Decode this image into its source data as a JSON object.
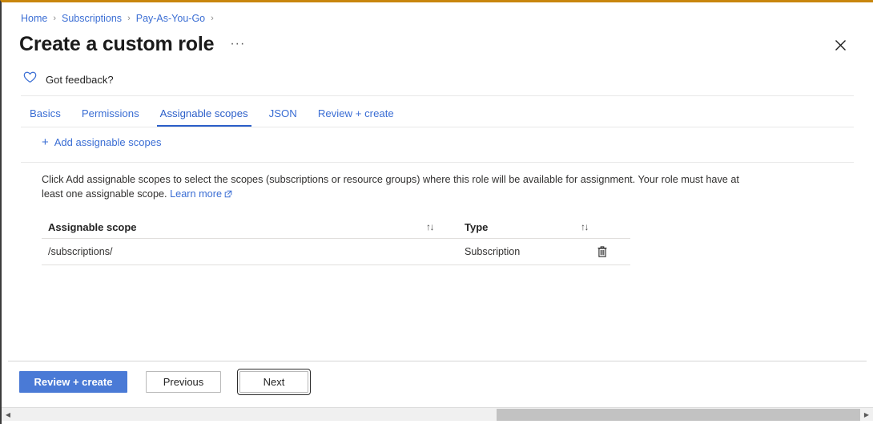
{
  "window": {
    "accent_top_border": "#c8860d",
    "close_icon": "close-icon"
  },
  "breadcrumb": {
    "items": [
      {
        "label": "Home"
      },
      {
        "label": "Subscriptions"
      },
      {
        "label": "Pay-As-You-Go"
      }
    ],
    "separator": "›"
  },
  "header": {
    "title": "Create a custom role",
    "ellipsis": "···"
  },
  "feedback": {
    "icon": "heart-icon",
    "label": "Got feedback?"
  },
  "tabs": [
    {
      "label": "Basics",
      "active": false
    },
    {
      "label": "Permissions",
      "active": false
    },
    {
      "label": "Assignable scopes",
      "active": true
    },
    {
      "label": "JSON",
      "active": false
    },
    {
      "label": "Review + create",
      "active": false
    }
  ],
  "command_bar": {
    "add_scope_plus": "+",
    "add_scope_label": "Add assignable scopes"
  },
  "description": {
    "text": "Click Add assignable scopes to select the scopes (subscriptions or resource groups) where this role will be available for assignment. Your role must have at least one assignable scope.",
    "link_label": "Learn more",
    "link_icon": "external-link-icon"
  },
  "table": {
    "columns": [
      {
        "key": "scope",
        "label": "Assignable scope",
        "sort_icon": "↑↓"
      },
      {
        "key": "type",
        "label": "Type",
        "sort_icon": "↑↓"
      }
    ],
    "rows": [
      {
        "scope": "/subscriptions/",
        "type": "Subscription",
        "delete_icon": "trash-icon"
      }
    ]
  },
  "footer": {
    "review_create_label": "Review + create",
    "previous_label": "Previous",
    "next_label": "Next",
    "primary_color": "#4a7ad6"
  },
  "scrollbar": {
    "left_arrow": "◀",
    "right_arrow": "▶",
    "orientation": "horizontal"
  }
}
